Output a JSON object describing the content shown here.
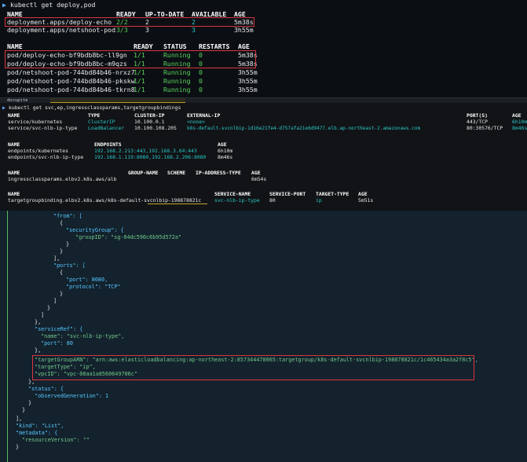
{
  "panel1": {
    "prompt": "kubectl get deploy,pod",
    "deploy_headers": [
      "NAME",
      "READY",
      "UP-TO-DATE",
      "AVAILABLE",
      "AGE"
    ],
    "deploy_rows": [
      [
        "deployment.apps/deploy-echo",
        "2/2",
        "2",
        "2",
        "5m38s"
      ],
      [
        "deployment.apps/netshoot-pod",
        "3/3",
        "3",
        "3",
        "3h55m"
      ]
    ],
    "pod_headers": [
      "NAME",
      "READY",
      "STATUS",
      "RESTARTS",
      "AGE"
    ],
    "pod_rows": [
      [
        "pod/deploy-echo-bf9bdb8bc-ll9gn",
        "1/1",
        "Running",
        "0",
        "5m38s"
      ],
      [
        "pod/deploy-echo-bf9bdb8bc-m9qzs",
        "1/1",
        "Running",
        "0",
        "5m38s"
      ],
      [
        "pod/netshoot-pod-744bd84b46-nrxz7",
        "1/1",
        "Running",
        "0",
        "3h55m"
      ],
      [
        "pod/netshoot-pod-744bd84b46-pkskw",
        "1/1",
        "Running",
        "0",
        "3h55m"
      ],
      [
        "pod/netshoot-pod-744bd84b46-tkrn8",
        "1/1",
        "Running",
        "0",
        "3h55m"
      ]
    ]
  },
  "panel2": {
    "tab_label": "docupite",
    "prompt": "kubectl get svc,ep,ingressclassparams,targetgroupbindings",
    "svc_headers": [
      "NAME",
      "TYPE",
      "CLUSTER-IP",
      "EXTERNAL-IP",
      "PORT(S)",
      "AGE"
    ],
    "svc_rows": [
      [
        "service/kubernetes",
        "ClusterIP",
        "10.100.0.1",
        "<none>",
        "443/TCP",
        "6h10m"
      ],
      [
        "service/svc-nlb-ip-type",
        "LoadBalancer",
        "10.100.108.205",
        "k8s-default-svcnlbip-1d16e21fe4-d757afa21e6d9477.elb.ap-northeast-2.amazonaws.com",
        "80:30576/TCP",
        "8m46s"
      ]
    ],
    "ep_headers": [
      "NAME",
      "ENDPOINTS",
      "AGE"
    ],
    "ep_rows": [
      [
        "endpoints/kubernetes",
        "192.168.2.213:443,192.168.3.64:443",
        "6h10m"
      ],
      [
        "endpoints/svc-nlb-ip-type",
        "192.168.1.119:8080,192.168.2.206:8080",
        "8m46s"
      ]
    ],
    "icp_headers": [
      "NAME",
      "GROUP-NAME",
      "SCHEME",
      "IP-ADDRESS-TYPE",
      "AGE"
    ],
    "icp_rows": [
      [
        "ingressclassparams.elbv2.k8s.aws/alb",
        "",
        "",
        "",
        "6m54s"
      ]
    ],
    "tgb_headers": [
      "NAME",
      "SERVICE-NAME",
      "SERVICE-PORT",
      "TARGET-TYPE",
      "AGE"
    ],
    "tgb_rows": [
      [
        "targetgroupbinding.elbv2.k8s.aws/k8s-default-svcnlbip-198878821c",
        "svc-nlb-ip-type",
        "80",
        "ip",
        "5m51s"
      ]
    ]
  },
  "panel3": {
    "lines": [
      "\"from\": [",
      "{",
      "\"securityGroup\": {",
      "\"groupID\": \"sg-04dc590c6b95d572a\"",
      "}",
      "}",
      "],",
      "\"ports\": [",
      "{",
      "\"port\": 8080,",
      "\"protocol\": \"TCP\"",
      "}",
      "]",
      "}",
      "]",
      "},",
      "\"serviceRef\": {",
      "\"name\": \"svc-nlb-ip-type\",",
      "\"port\": 80",
      "},",
      "\"targetGroupARN\": \"arn:aws:elasticloadbalancing:ap-northeast-2:857344478065:targetgroup/k8s-default-svcnlbip-198878821c/1c465434a3a2f8c5\",",
      "\"targetType\": \"ip\",",
      "\"vpcID\": \"vpc-08aa1a8560649706c\"",
      "},",
      "\"status\": {",
      "\"observedGeneration\": 1",
      "}",
      "}",
      "],",
      "\"kind\": \"List\",",
      "\"metadata\": {",
      "\"resourceVersion\": \"\"",
      "}"
    ]
  },
  "colors": {
    "red_box": "#d9363e",
    "green": "#5ad45a",
    "cyan": "#2bc7c7",
    "json_key": "#55c7ff",
    "json_string": "#72c98b"
  }
}
